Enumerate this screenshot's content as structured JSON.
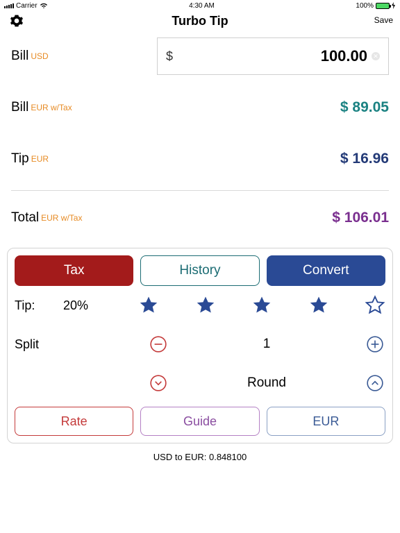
{
  "status": {
    "carrier": "Carrier",
    "time": "4:30 AM",
    "battery": "100%"
  },
  "header": {
    "title": "Turbo Tip",
    "save": "Save"
  },
  "rows": {
    "bill": {
      "label": "Bill",
      "tag": "USD",
      "symbol": "$",
      "value": "100.00"
    },
    "billConv": {
      "label": "Bill",
      "tag": "EUR w/Tax",
      "value": "$ 89.05"
    },
    "tip": {
      "label": "Tip",
      "tag": "EUR",
      "value": "$ 16.96"
    },
    "total": {
      "label": "Total",
      "tag": "EUR w/Tax",
      "value": "$ 106.01"
    }
  },
  "panel": {
    "seg": {
      "tax": "Tax",
      "history": "History",
      "convert": "Convert"
    },
    "tipLabel": "Tip:",
    "tipPct": "20%",
    "splitLabel": "Split",
    "splitValue": "1",
    "roundLabel": "Round",
    "bottom": {
      "rate": "Rate",
      "guide": "Guide",
      "currency": "EUR"
    }
  },
  "footer": "USD to EUR: 0.848100"
}
